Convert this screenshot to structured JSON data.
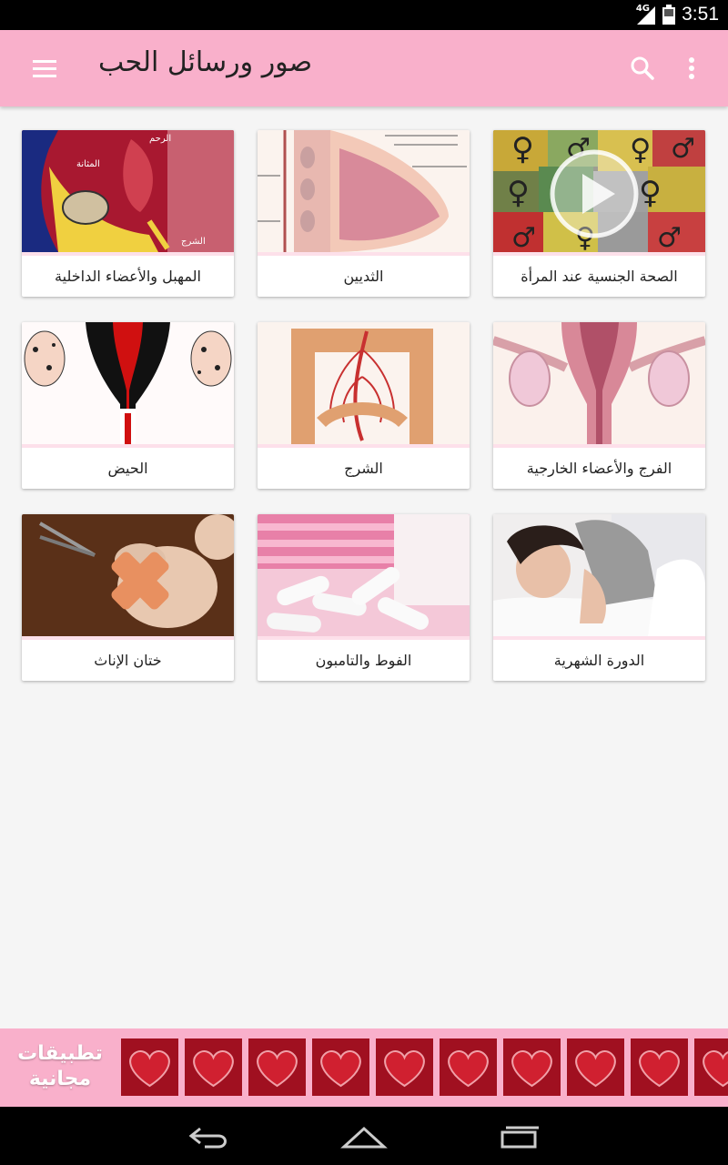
{
  "status": {
    "time": "3:51",
    "network": "4G"
  },
  "appbar": {
    "title": "صور ورسائل الحب"
  },
  "cards": [
    {
      "label": "الصحة الجنسية عند المرأة",
      "image": "gender-symbols-video-thumbnail"
    },
    {
      "label": "الثديين",
      "image": "breast-anatomy-diagram"
    },
    {
      "label": "المهبل والأعضاء الداخلية",
      "image": "pelvis-anatomy-diagram"
    },
    {
      "label": "الفرج والأعضاء الخارجية",
      "image": "uterus-diagram"
    },
    {
      "label": "الشرج",
      "image": "colon-anatomy-diagram"
    },
    {
      "label": "الحيض",
      "image": "menstruation-diagram"
    },
    {
      "label": "الدورة الشهرية",
      "image": "woman-in-pain-photo"
    },
    {
      "label": "الفوط والتامبون",
      "image": "tampons-and-pads-photo"
    },
    {
      "label": "ختان الإناث",
      "image": "doll-and-scissors-photo"
    }
  ],
  "banner": {
    "line1": "تطبيقات",
    "line2": "مجانية"
  },
  "colors": {
    "appbar": "#f9b0cb",
    "heart_tile": "#a01020",
    "background": "#f5f5f5"
  }
}
